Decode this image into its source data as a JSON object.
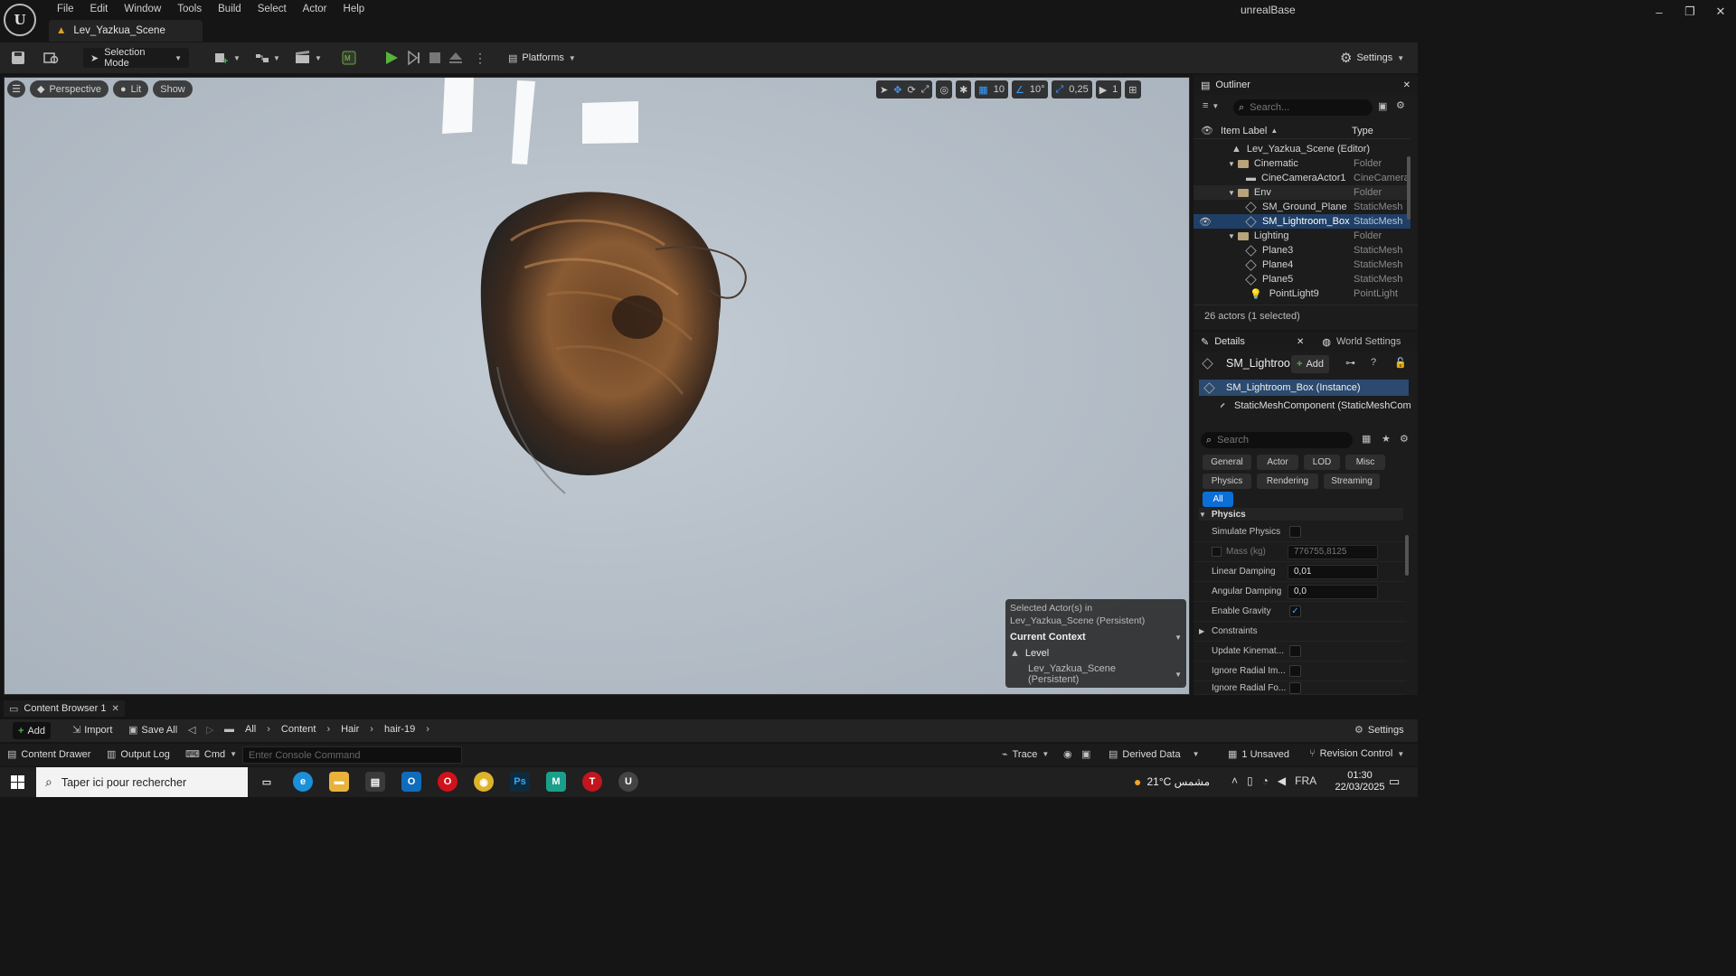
{
  "app": {
    "name": "unrealBase",
    "level_tab": "Lev_Yazkua_Scene",
    "menu": [
      "File",
      "Edit",
      "Window",
      "Tools",
      "Build",
      "Select",
      "Actor",
      "Help"
    ]
  },
  "toolbar": {
    "selection_mode": "Selection Mode",
    "platforms": "Platforms",
    "settings": "Settings"
  },
  "viewport": {
    "perspective": "Perspective",
    "lit": "Lit",
    "show": "Show",
    "grid_snap": "10",
    "rotation_snap": "10°",
    "scale_snap": "0,25",
    "camera_speed": "1"
  },
  "context_panel": {
    "selected_line1": "Selected Actor(s) in",
    "selected_line2": "Lev_Yazkua_Scene (Persistent)",
    "current_context": "Current Context",
    "level_label": "Level",
    "level_value": "Lev_Yazkua_Scene (Persistent)"
  },
  "outliner": {
    "title": "Outliner",
    "search_placeholder": "Search...",
    "col_label": "Item Label",
    "col_type": "Type",
    "items": [
      {
        "name": "Lev_Yazkua_Scene (Editor)",
        "type": ""
      },
      {
        "name": "Cinematic",
        "type": "Folder"
      },
      {
        "name": "CineCameraActor1",
        "type": "CineCamera"
      },
      {
        "name": "Env",
        "type": "Folder"
      },
      {
        "name": "SM_Ground_Plane",
        "type": "StaticMesh"
      },
      {
        "name": "SM_Lightroom_Box",
        "type": "StaticMesh"
      },
      {
        "name": "Lighting",
        "type": "Folder"
      },
      {
        "name": "Plane3",
        "type": "StaticMesh"
      },
      {
        "name": "Plane4",
        "type": "StaticMesh"
      },
      {
        "name": "Plane5",
        "type": "StaticMesh"
      },
      {
        "name": "PointLight9",
        "type": "PointLight"
      }
    ],
    "count": "26 actors (1 selected)"
  },
  "details": {
    "tab": "Details",
    "world_settings": "World Settings",
    "actor_name": "SM_Lightroo",
    "add": "Add",
    "instance": "SM_Lightroom_Box (Instance)",
    "component": "StaticMeshComponent (StaticMeshComp",
    "search_placeholder": "Search",
    "categories": [
      "General",
      "Actor",
      "LOD",
      "Misc",
      "Physics",
      "Rendering",
      "Streaming",
      "All"
    ],
    "section": "Physics",
    "props": {
      "simulate_physics": "Simulate Physics",
      "mass": "Mass (kg)",
      "mass_value": "776755,8125",
      "linear_damping": "Linear Damping",
      "linear_damping_value": "0,01",
      "angular_damping": "Angular Damping",
      "angular_damping_value": "0,0",
      "enable_gravity": "Enable Gravity",
      "constraints": "Constraints",
      "update_kinematic": "Update Kinemat...",
      "ignore_radial_impulse": "Ignore Radial Im...",
      "ignore_radial_force": "Ignore Radial Fo..."
    }
  },
  "content_browser": {
    "tab": "Content Browser 1",
    "add": "Add",
    "import": "Import",
    "save_all": "Save All",
    "crumbs": [
      "All",
      "Content",
      "Hair",
      "hair-19"
    ],
    "settings": "Settings"
  },
  "statusbar": {
    "content_drawer": "Content Drawer",
    "output_log": "Output Log",
    "cmd": "Cmd",
    "console_placeholder": "Enter Console Command",
    "trace": "Trace",
    "derived_data": "Derived Data",
    "unsaved": "1 Unsaved",
    "revision_control": "Revision Control"
  },
  "taskbar": {
    "search_placeholder": "Taper ici pour rechercher",
    "weather": "21°C  مشمس",
    "lang": "FRA",
    "time": "01:30",
    "date": "22/03/2025"
  }
}
